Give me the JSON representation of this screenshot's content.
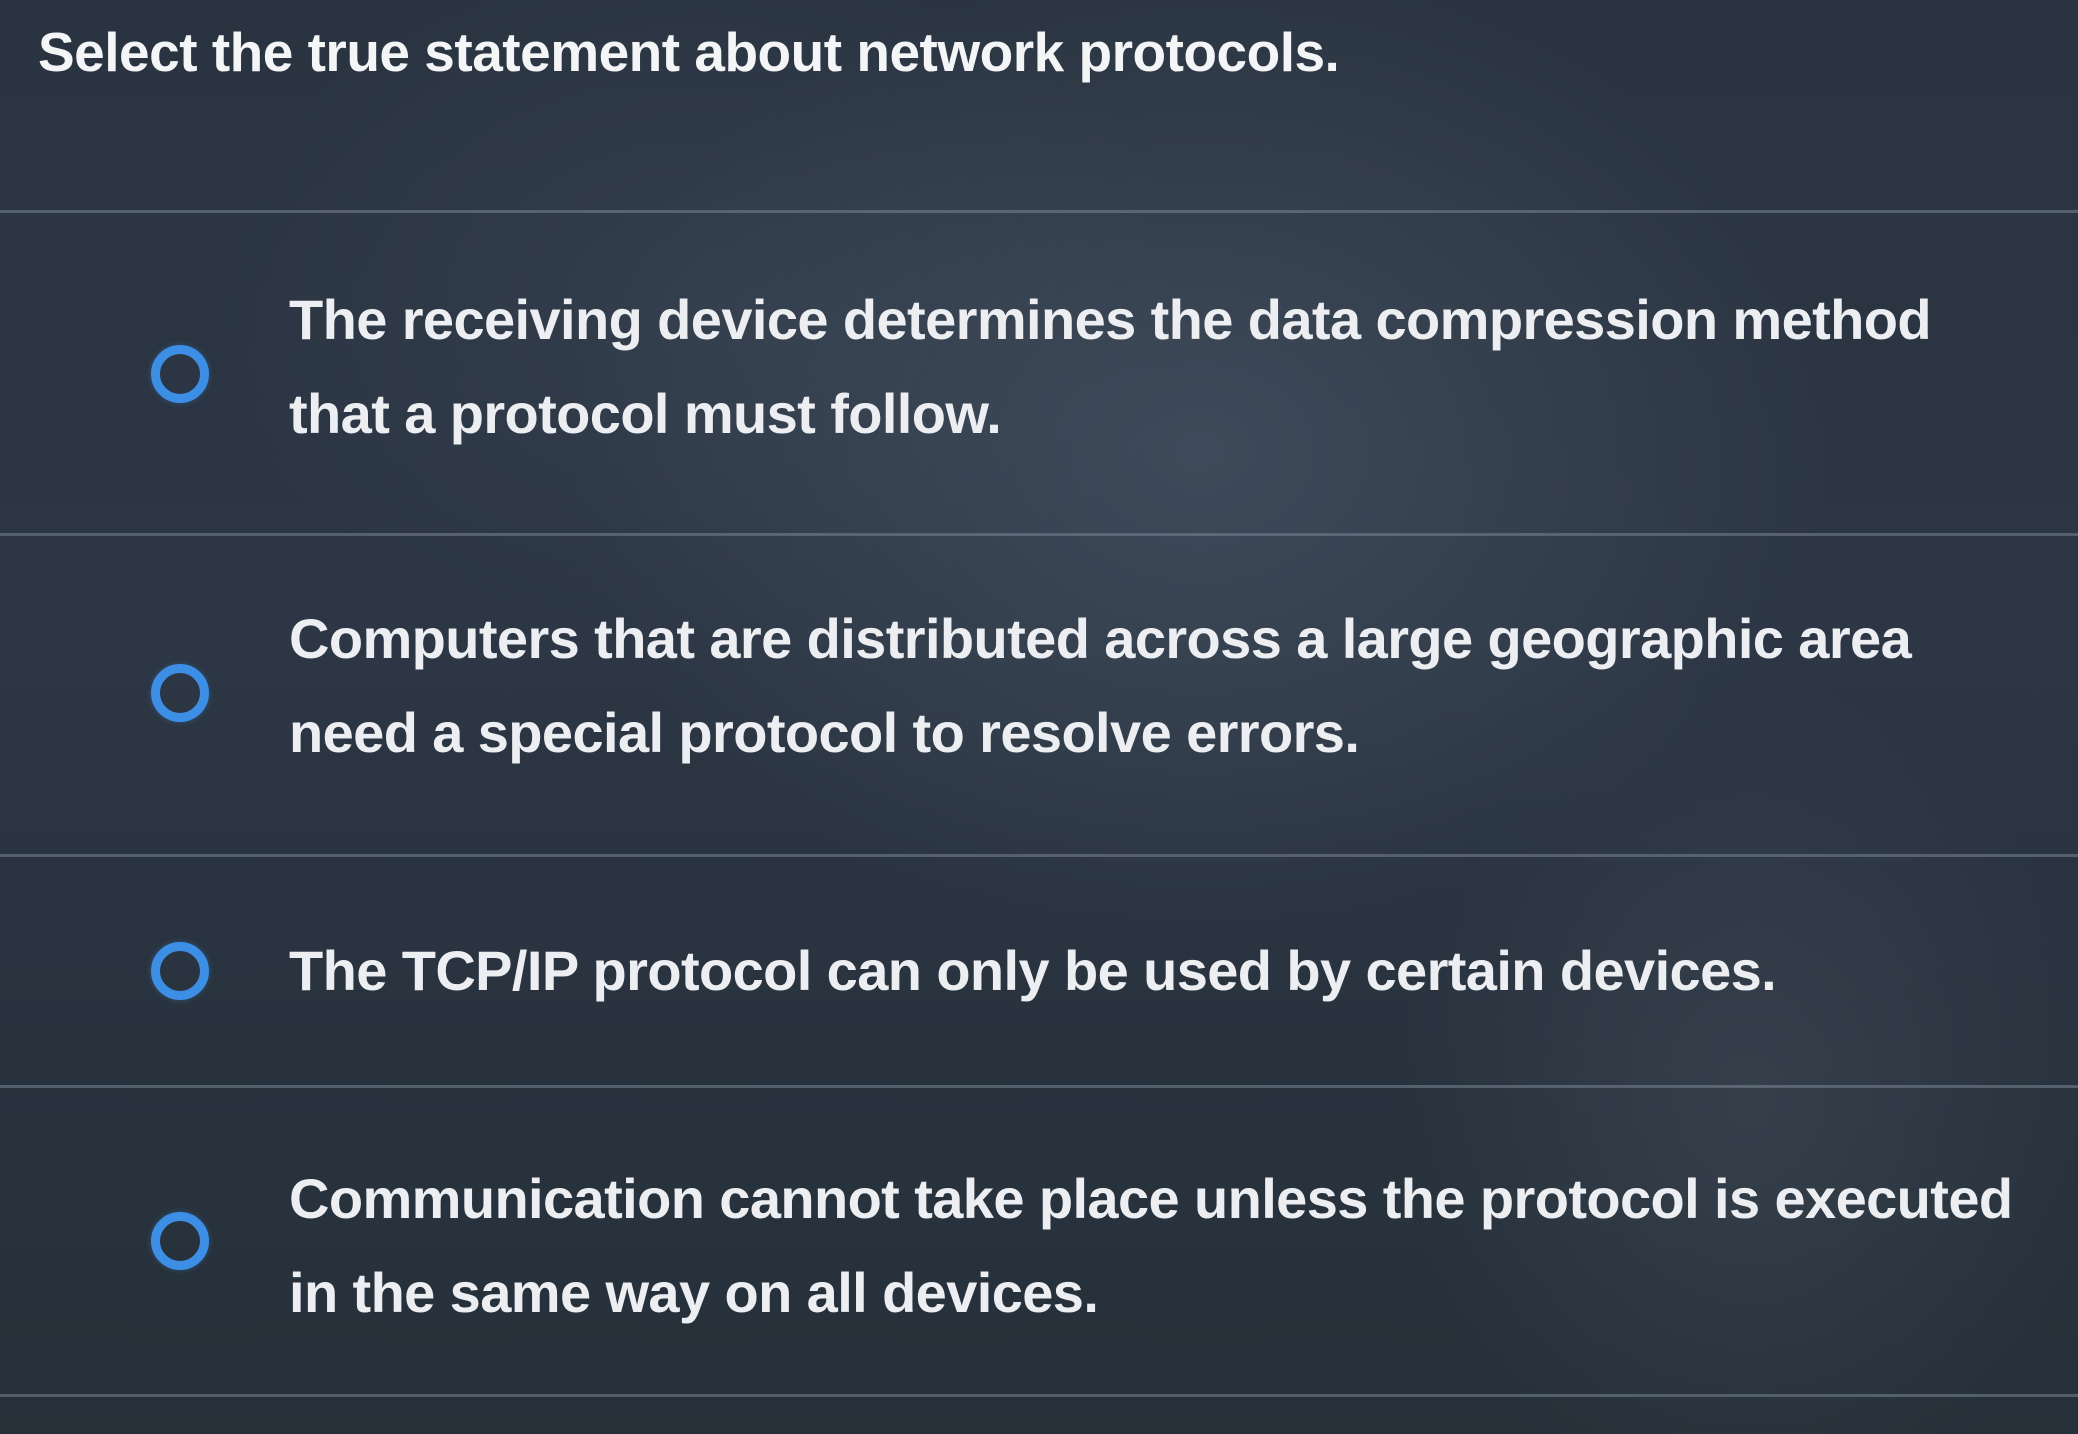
{
  "question": {
    "text": "Select the true statement about network protocols."
  },
  "options": [
    {
      "label": "The receiving device determines the data compression method that a protocol must follow.",
      "selected": false,
      "icon": "radio-unchecked-icon"
    },
    {
      "label": "Computers that are distributed across a large geographic area need a special protocol to resolve errors.",
      "selected": false,
      "icon": "radio-unchecked-icon"
    },
    {
      "label": "The TCP/IP protocol can only be used by certain devices.",
      "selected": false,
      "icon": "radio-unchecked-icon"
    },
    {
      "label": "Communication cannot take place unless the protocol is executed in the same way on all devices.",
      "selected": false,
      "icon": "radio-unchecked-icon"
    }
  ],
  "colors": {
    "background": "#2a3441",
    "radio_accent": "#3d8fe6",
    "text": "#eceef2",
    "divider": "#78849a"
  }
}
